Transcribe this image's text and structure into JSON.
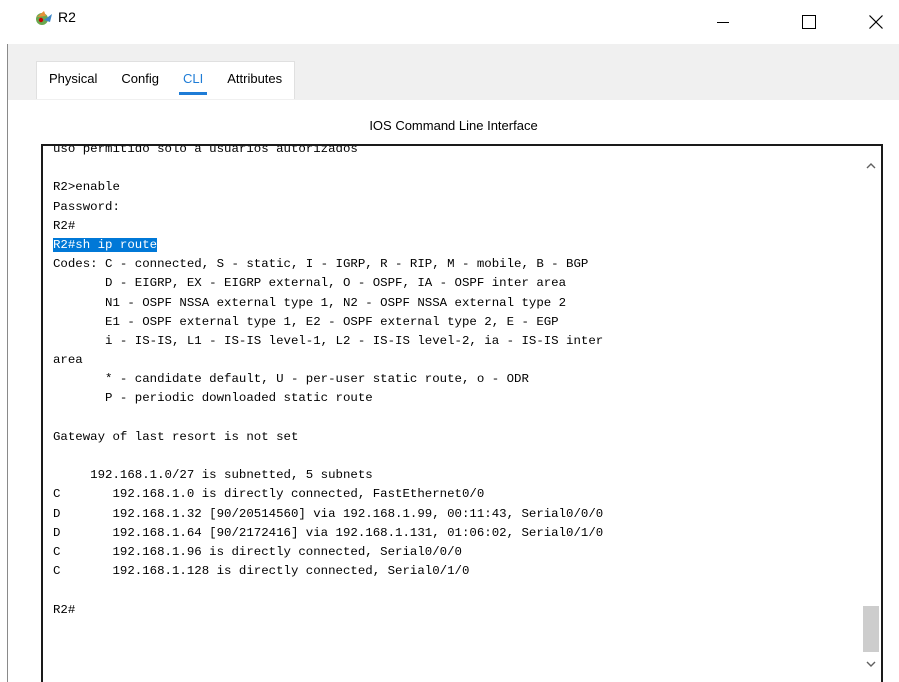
{
  "window": {
    "title": "R2",
    "icon": "packet-tracer-router-icon",
    "buttons": [
      "minimize-icon",
      "maximize-icon",
      "close-icon"
    ]
  },
  "tabs": [
    {
      "label": "Physical",
      "active": false
    },
    {
      "label": "Config",
      "active": false
    },
    {
      "label": "CLI",
      "active": true
    },
    {
      "label": "Attributes",
      "active": false
    }
  ],
  "panel": {
    "title": "IOS Command Line Interface"
  },
  "terminal": {
    "lines": [
      "uso permitido solo a usuarios autorizados",
      "",
      "R2>enable",
      "Password:",
      "R2#",
      "R2#sh ip route",
      "Codes: C - connected, S - static, I - IGRP, R - RIP, M - mobile, B - BGP",
      "       D - EIGRP, EX - EIGRP external, O - OSPF, IA - OSPF inter area",
      "       N1 - OSPF NSSA external type 1, N2 - OSPF NSSA external type 2",
      "       E1 - OSPF external type 1, E2 - OSPF external type 2, E - EGP",
      "       i - IS-IS, L1 - IS-IS level-1, L2 - IS-IS level-2, ia - IS-IS inter",
      "area",
      "       * - candidate default, U - per-user static route, o - ODR",
      "       P - periodic downloaded static route",
      "",
      "Gateway of last resort is not set",
      "",
      "     192.168.1.0/27 is subnetted, 5 subnets",
      "C       192.168.1.0 is directly connected, FastEthernet0/0",
      "D       192.168.1.32 [90/20514560] via 192.168.1.99, 00:11:43, Serial0/0/0",
      "D       192.168.1.64 [90/2172416] via 192.168.1.131, 01:06:02, Serial0/1/0",
      "C       192.168.1.96 is directly connected, Serial0/0/0",
      "C       192.168.1.128 is directly connected, Serial0/1/0",
      "",
      "R2#"
    ],
    "highlighted_line": "R2#sh ip route"
  },
  "colors": {
    "accent": "#1e7cd6",
    "selection": "#0078d7",
    "tabstrip_bg": "#f0f0f0",
    "scroll_thumb": "#cdcdcd"
  }
}
